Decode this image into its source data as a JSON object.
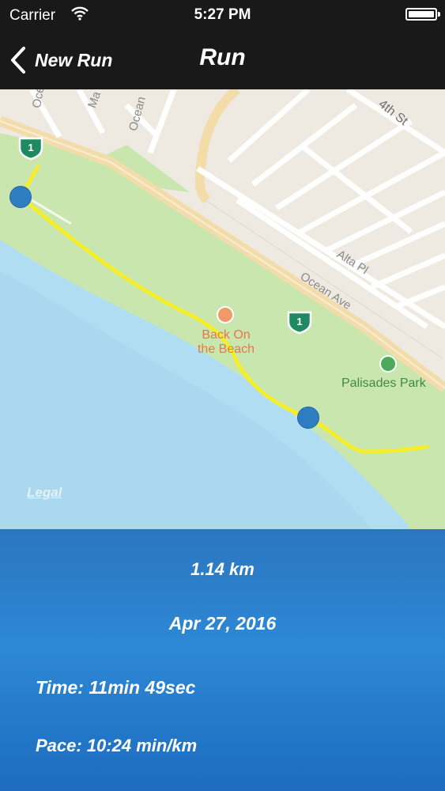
{
  "status_bar": {
    "carrier": "Carrier",
    "time": "5:27 PM"
  },
  "nav": {
    "back_label": "New Run",
    "title": "Run"
  },
  "map": {
    "street_labels": [
      "Ocea",
      "Ma",
      "Ocean",
      "4th St",
      "Alta Pl",
      "Ocean Ave"
    ],
    "highway_shield": "1",
    "poi_name_line1": "Back On",
    "poi_name_line2": "the Beach",
    "park_name": "Palisades Park",
    "legal": "Legal",
    "route_color": "#f4ee2b",
    "marker_color": "#2f7ec2"
  },
  "run": {
    "distance": "1.14 km",
    "date": "Apr 27, 2016",
    "time": "Time: 11min 49sec",
    "pace": "Pace: 10:24 min/km"
  }
}
